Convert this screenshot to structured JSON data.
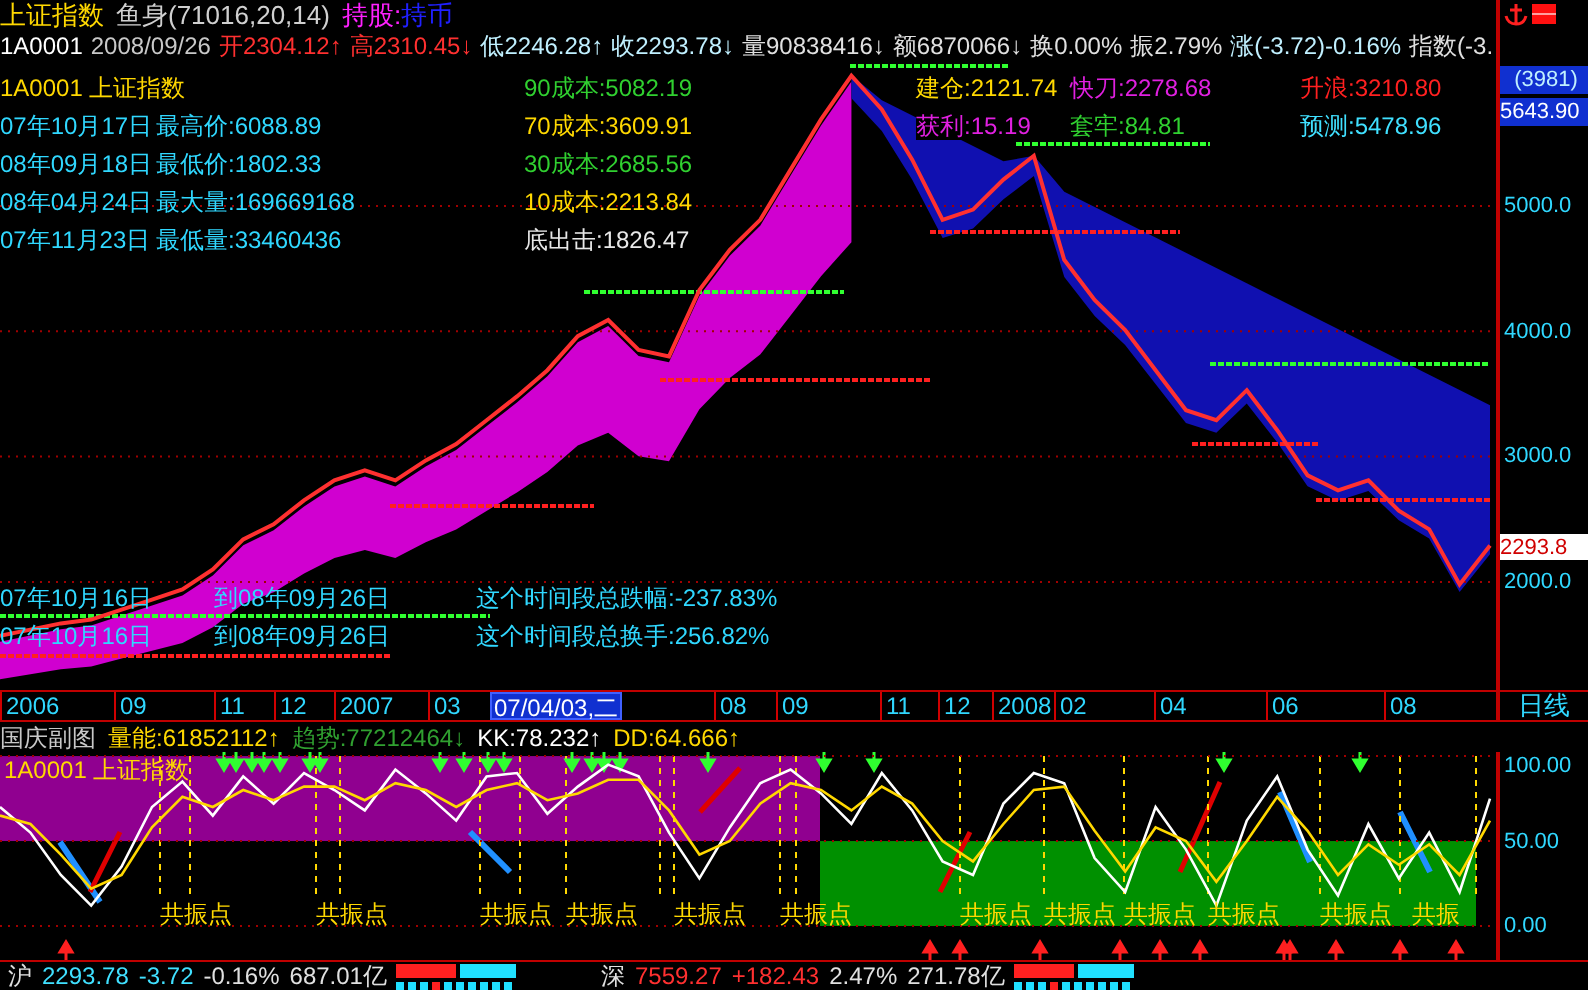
{
  "header": {
    "name": "上证指数",
    "indicator": "鱼身(71016,20,14)",
    "hold_label": "持股:",
    "cash_label": "持币"
  },
  "quote": {
    "code": "1A0001",
    "date": "2008/09/26",
    "fields": [
      {
        "text": "开2304.12↑",
        "color": "#ff3030"
      },
      {
        "text": "高2310.45↓",
        "color": "#ff3030"
      },
      {
        "text": "低2246.28↑",
        "color": "#c0f0ff"
      },
      {
        "text": "收2293.78↓",
        "color": "#c0f0ff"
      },
      {
        "text": "量90838416↓",
        "color": "#e0e0e0"
      },
      {
        "text": "额6870066↓",
        "color": "#e0e0e0"
      },
      {
        "text": "换0.00%",
        "color": "#e0e0e0"
      },
      {
        "text": "振2.79%",
        "color": "#e0e0e0"
      },
      {
        "text": "涨(-3.72)-0.16%",
        "color": "#c0f0ff"
      },
      {
        "text": "指数(-3.",
        "color": "#e0e0e0"
      }
    ]
  },
  "info_panel": {
    "title": "1A0001 上证指数",
    "rows": [
      {
        "date": "07年10月17日",
        "label": "最高价:6088.89"
      },
      {
        "date": "08年09月18日",
        "label": "最低价:1802.33"
      },
      {
        "date": "08年04月24日",
        "label": "最大量:169669168"
      },
      {
        "date": "07年11月23日",
        "label": "最低量:33460436"
      }
    ]
  },
  "cost_lines": [
    {
      "text": "90成本:5082.19",
      "color": "#30d030"
    },
    {
      "text": "70成本:3609.91",
      "color": "#ffd800"
    },
    {
      "text": "30成本:2685.56",
      "color": "#30d030"
    },
    {
      "text": "10成本:2213.84",
      "color": "#ffd800"
    },
    {
      "text": "底出击:1826.47",
      "color": "#e8e8e8"
    }
  ],
  "signals": [
    {
      "text": "建仓:2121.74",
      "color": "#ffd800"
    },
    {
      "text": "快刀:2278.68",
      "color": "#e020e0"
    },
    {
      "text": "升浪:3210.80",
      "color": "#ff2020"
    },
    {
      "text": "获利:15.19",
      "color": "#e020e0"
    },
    {
      "text": "套牢:84.81",
      "color": "#30d030"
    },
    {
      "text": "预测:5478.96",
      "color": "#40e0ff"
    }
  ],
  "period_rows": [
    {
      "from": "07年10月16日",
      "to": "到08年09月26日",
      "summary": "这个时间段总跌幅:-237.83%"
    },
    {
      "from": "07年10月16日",
      "to": "到08年09月26日",
      "summary": "这个时间段总换手:256.82%"
    }
  ],
  "main_chart": {
    "count_label": "(3981)",
    "high_label": "5643.90",
    "last_label": "2293.8",
    "chart_data": {
      "type": "line",
      "grid": true,
      "ylim": [
        1138,
        6643
      ],
      "yticks": [
        {
          "value": 2000,
          "label": "2000.0"
        },
        {
          "value": 3000,
          "label": "3000.0"
        },
        {
          "value": 4000,
          "label": "4000.0"
        },
        {
          "value": 5000,
          "label": "5000.0"
        }
      ],
      "series": [
        {
          "color": "#ff3030",
          "values": [
            1570,
            1620,
            1670,
            1700,
            1780,
            1860,
            1940,
            2100,
            2340,
            2460,
            2650,
            2810,
            2890,
            2810,
            2970,
            3100,
            3290,
            3480,
            3690,
            3960,
            4090,
            3850,
            3800,
            4330,
            4650,
            4890,
            5290,
            5690,
            6040,
            5770,
            5370,
            4890,
            4970,
            5210,
            5400,
            4570,
            4250,
            4010,
            3690,
            3370,
            3290,
            3530,
            3210,
            2850,
            2730,
            2810,
            2570,
            2420,
            1980,
            2290
          ]
        }
      ]
    }
  },
  "time_axis": [
    {
      "label": "2006",
      "selected": false
    },
    {
      "label": "09",
      "selected": false
    },
    {
      "label": "11",
      "selected": false
    },
    {
      "label": "12",
      "selected": false
    },
    {
      "label": "2007",
      "selected": false
    },
    {
      "label": "03",
      "selected": false
    },
    {
      "label": "07/04/03,二",
      "selected": true
    },
    {
      "label": "08",
      "selected": false
    },
    {
      "label": "09",
      "selected": false
    },
    {
      "label": "11",
      "selected": false
    },
    {
      "label": "12",
      "selected": false
    },
    {
      "label": "2008",
      "selected": false
    },
    {
      "label": "02",
      "selected": false
    },
    {
      "label": "04",
      "selected": false
    },
    {
      "label": "06",
      "selected": false
    },
    {
      "label": "08",
      "selected": false
    }
  ],
  "period_label": "日线",
  "sub_chart": {
    "name": "国庆副图",
    "fields": [
      {
        "text": "量能:61852112↑",
        "color": "#ffd800"
      },
      {
        "text": "趋势:77212464↓",
        "color": "#30a030"
      },
      {
        "text": "KK:78.232↑",
        "color": "#ffffff"
      },
      {
        "text": "DD:64.666↑",
        "color": "#ffd800"
      }
    ],
    "title": "1A0001 上证指数",
    "resonance_labels": [
      "共振点",
      "共振点",
      "共振点",
      "共振点",
      "共振点",
      "共振点",
      "共振点",
      "共振点",
      "共振点",
      "共振点",
      "共振点",
      "共振"
    ],
    "chart_data": {
      "type": "line",
      "grid": true,
      "ylim": [
        -20,
        102.4
      ],
      "yticks": [
        {
          "value": 0,
          "label": "0.00"
        },
        {
          "value": 50,
          "label": "50.00"
        },
        {
          "value": 100,
          "label": "100.00"
        }
      ],
      "series": [
        {
          "color": "#ffffff",
          "values": [
            70,
            55,
            30,
            12,
            35,
            70,
            85,
            65,
            88,
            72,
            90,
            80,
            68,
            92,
            78,
            62,
            88,
            90,
            66,
            82,
            95,
            88,
            55,
            28,
            58,
            84,
            92,
            78,
            60,
            90,
            68,
            38,
            30,
            72,
            90,
            84,
            40,
            20,
            70,
            45,
            12,
            62,
            88,
            45,
            18,
            60,
            28,
            55,
            20,
            75
          ]
        },
        {
          "color": "#ffd800",
          "values": [
            65,
            60,
            42,
            22,
            30,
            58,
            76,
            70,
            80,
            74,
            82,
            82,
            74,
            84,
            80,
            70,
            80,
            84,
            74,
            78,
            86,
            86,
            68,
            42,
            50,
            72,
            84,
            80,
            68,
            82,
            72,
            50,
            38,
            60,
            80,
            82,
            56,
            32,
            58,
            50,
            26,
            50,
            76,
            56,
            30,
            48,
            36,
            48,
            30,
            62
          ]
        }
      ]
    }
  },
  "status_bar": {
    "markets": [
      {
        "name": "沪",
        "price": "2293.78",
        "change": "-3.72",
        "percent": "-0.16%",
        "amount": "687.01亿",
        "color": "#40e0ff"
      },
      {
        "name": "深",
        "price": "7559.27",
        "change": "+182.43",
        "percent": "2.47%",
        "amount": "271.78亿",
        "color": "#ff3030"
      }
    ]
  }
}
